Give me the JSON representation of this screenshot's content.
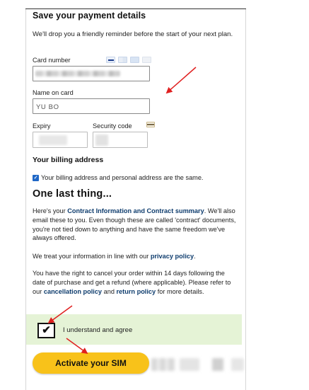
{
  "form": {
    "title": "Save your payment details",
    "intro": "We'll drop you a friendly reminder before the start of your next plan.",
    "card_number_label": "Card number",
    "card_number_value": "",
    "name_label": "Name on card",
    "name_value": "YU BO",
    "expiry_label": "Expiry",
    "security_label": "Security code"
  },
  "billing": {
    "heading": "Your billing address",
    "checkbox_label": "Your billing address and personal address are the same.",
    "checked": true
  },
  "last": {
    "heading": "One last thing...",
    "p1_a": "Here's your ",
    "p1_link": "Contract Information and Contract summary",
    "p1_b": ". We'll also email these to you. Even though these are called 'contract' documents, you're not tied down to anything and have the same freedom we've always offered.",
    "p2_a": "We treat your information in line with our ",
    "p2_link": "privacy policy",
    "p2_b": ".",
    "p3_a": "You have the right to cancel your order within 14 days following the date of purchase and get a refund (where applicable). Please refer to our ",
    "p3_link1": "cancellation policy",
    "p3_mid": " and ",
    "p3_link2": "return policy",
    "p3_b": " for more details."
  },
  "agree": {
    "label": "I understand and agree",
    "checkmark": "✔",
    "checked": true
  },
  "actions": {
    "activate_label": "Activate your SIM"
  },
  "colors": {
    "accent_yellow": "#f8c21a",
    "link_blue": "#0f3d6e",
    "agree_bg": "#e5f3d6",
    "annotation_red": "#e02020"
  }
}
